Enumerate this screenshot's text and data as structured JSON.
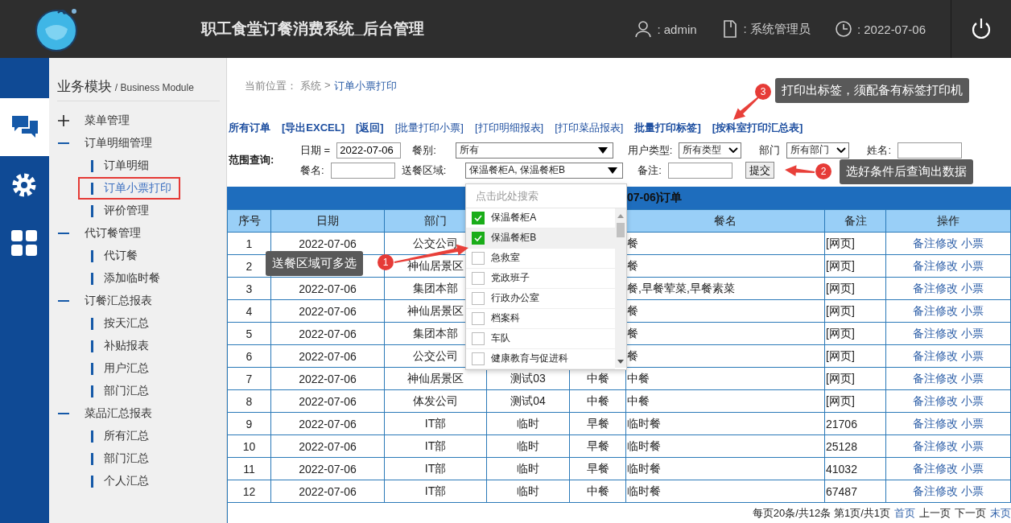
{
  "header": {
    "title": "职工食堂订餐消费系统_后台管理",
    "info": [
      {
        "kind": "user",
        "text": ": admin"
      },
      {
        "kind": "document",
        "text": ": 系统管理员"
      },
      {
        "kind": "clock",
        "text": ": 2022-07-06"
      }
    ]
  },
  "rail": [
    {
      "kind": "chat",
      "selected": true
    },
    {
      "kind": "gear",
      "selected": false
    },
    {
      "kind": "grid",
      "selected": false
    }
  ],
  "sidebar": {
    "title": "业务模块",
    "subtitle": "/ Business Module",
    "groups": [
      {
        "label": "菜单管理",
        "expanded": false
      },
      {
        "label": "订单明细管理",
        "expanded": true,
        "children": [
          {
            "label": "订单明细",
            "selected": false
          },
          {
            "label": "订单小票打印",
            "selected": true
          },
          {
            "label": "评价管理",
            "selected": false
          }
        ]
      },
      {
        "label": "代订餐管理",
        "expanded": true,
        "children": [
          {
            "label": "代订餐",
            "selected": false
          },
          {
            "label": "添加临时餐",
            "selected": false
          }
        ]
      },
      {
        "label": "订餐汇总报表",
        "expanded": true,
        "children": [
          {
            "label": "按天汇总",
            "selected": false
          },
          {
            "label": "补贴报表",
            "selected": false
          },
          {
            "label": "用户汇总",
            "selected": false
          },
          {
            "label": "部门汇总",
            "selected": false
          }
        ]
      },
      {
        "label": "菜品汇总报表",
        "expanded": true,
        "children": [
          {
            "label": "所有汇总",
            "selected": false
          },
          {
            "label": "部门汇总",
            "selected": false
          },
          {
            "label": "个人汇总",
            "selected": false
          }
        ]
      }
    ]
  },
  "breadcrumb": {
    "label": "当前位置：",
    "items": [
      "系统",
      ">",
      "订单小票打印"
    ]
  },
  "toolbar": [
    {
      "text": "所有订单",
      "bold": true
    },
    {
      "text": "[导出EXCEL]",
      "bold": true
    },
    {
      "text": "[返回]",
      "bold": true
    },
    {
      "text": "[批量打印小票]",
      "bold": false
    },
    {
      "text": "[打印明细报表]",
      "bold": false
    },
    {
      "text": "[打印菜品报表]",
      "bold": false
    },
    {
      "text": "批量打印标签]",
      "bold": true
    },
    {
      "text": "[按科室打印汇总表]",
      "bold": true
    }
  ],
  "filter": {
    "label": "范围查询:",
    "rows": [
      [
        {
          "kind": "label",
          "text": "日期 ="
        },
        {
          "kind": "input",
          "value": "2022-07-06"
        },
        {
          "kind": "label",
          "text": "餐别:"
        },
        {
          "kind": "combo",
          "value": "所有"
        },
        {
          "kind": "label",
          "text": "用户类型:"
        },
        {
          "kind": "select",
          "value": "所有类型"
        },
        {
          "kind": "label",
          "text": "部门"
        },
        {
          "kind": "select",
          "value": "所有部门"
        },
        {
          "kind": "label",
          "text": "姓名:"
        },
        {
          "kind": "input"
        }
      ],
      [
        {
          "kind": "label",
          "text": "餐名:"
        },
        {
          "kind": "input"
        },
        {
          "kind": "label",
          "text": "送餐区域:"
        },
        {
          "kind": "combo",
          "value": "保温餐柜A, 保温餐柜B",
          "open": true,
          "search_placeholder": "点击此处搜索",
          "options": [
            {
              "label": "保温餐柜A",
              "checked": true,
              "hovered": false
            },
            {
              "label": "保温餐柜B",
              "checked": true,
              "hovered": true
            },
            {
              "label": "急救室",
              "checked": false,
              "hovered": false
            },
            {
              "label": "党政班子",
              "checked": false,
              "hovered": false
            },
            {
              "label": "行政办公室",
              "checked": false,
              "hovered": false
            },
            {
              "label": "档案科",
              "checked": false,
              "hovered": false
            },
            {
              "label": "车队",
              "checked": false,
              "hovered": false
            },
            {
              "label": "健康教育与促进科",
              "checked": false,
              "hovered": false
            }
          ]
        },
        {
          "kind": "label",
          "text": "备注:"
        },
        {
          "kind": "input"
        },
        {
          "kind": "button",
          "text": "提交"
        }
      ]
    ]
  },
  "table": {
    "title": "07-06)订单",
    "columns": [
      "序号",
      "日期",
      "部门",
      null,
      null,
      "餐名",
      "备注",
      "操作"
    ],
    "rows": [
      {
        "cells": [
          "1",
          "2022-07-06",
          "公交公司",
          null,
          null,
          "餐",
          "[网页]"
        ],
        "actions": [
          "备注修改",
          "小票"
        ]
      },
      {
        "cells": [
          "2",
          null,
          "神仙居景区",
          null,
          null,
          "餐",
          "[网页]"
        ],
        "actions": [
          "备注修改",
          "小票"
        ]
      },
      {
        "cells": [
          "3",
          "2022-07-06",
          "集团本部",
          null,
          null,
          "餐,早餐荤菜,早餐素菜",
          "[网页]"
        ],
        "actions": [
          "备注修改",
          "小票"
        ]
      },
      {
        "cells": [
          "4",
          "2022-07-06",
          "神仙居景区",
          null,
          null,
          "餐",
          "[网页]"
        ],
        "actions": [
          "备注修改",
          "小票"
        ]
      },
      {
        "cells": [
          "5",
          "2022-07-06",
          "集团本部",
          null,
          null,
          "餐",
          "[网页]"
        ],
        "actions": [
          "备注修改",
          "小票"
        ]
      },
      {
        "cells": [
          "6",
          "2022-07-06",
          "公交公司",
          null,
          null,
          "餐",
          "[网页]"
        ],
        "actions": [
          "备注修改",
          "小票"
        ]
      },
      {
        "cells": [
          "7",
          "2022-07-06",
          "神仙居景区",
          "测试03",
          "中餐",
          "中餐",
          "[网页]"
        ],
        "actions": [
          "备注修改",
          "小票"
        ]
      },
      {
        "cells": [
          "8",
          "2022-07-06",
          "体发公司",
          "测试04",
          "中餐",
          "中餐",
          "[网页]"
        ],
        "actions": [
          "备注修改",
          "小票"
        ]
      },
      {
        "cells": [
          "9",
          "2022-07-06",
          "IT部",
          "临时",
          "早餐",
          "临时餐",
          "21706"
        ],
        "actions": [
          "备注修改",
          "小票"
        ]
      },
      {
        "cells": [
          "10",
          "2022-07-06",
          "IT部",
          "临时",
          "早餐",
          "临时餐",
          "25128"
        ],
        "actions": [
          "备注修改",
          "小票"
        ]
      },
      {
        "cells": [
          "11",
          "2022-07-06",
          "IT部",
          "临时",
          "早餐",
          "临时餐",
          "41032"
        ],
        "actions": [
          "备注修改",
          "小票"
        ]
      },
      {
        "cells": [
          "12",
          "2022-07-06",
          "IT部",
          "临时",
          "中餐",
          "临时餐",
          "67487"
        ],
        "actions": [
          "备注修改",
          "小票"
        ]
      }
    ]
  },
  "pagination": {
    "summary": "每页20条/共12条 第1页/共1页",
    "links": [
      {
        "text": "首页",
        "disabled": false
      },
      {
        "text": "上一页",
        "disabled": true
      },
      {
        "text": "下一页",
        "disabled": true
      },
      {
        "text": "末页",
        "disabled": false
      }
    ]
  },
  "callouts": [
    {
      "number": "3",
      "text": "打印出标签，须配备有标签打印机"
    },
    {
      "number": "2",
      "text": "选好条件后查询出数据"
    },
    {
      "number": "1",
      "text": "送餐区域可多选"
    }
  ]
}
